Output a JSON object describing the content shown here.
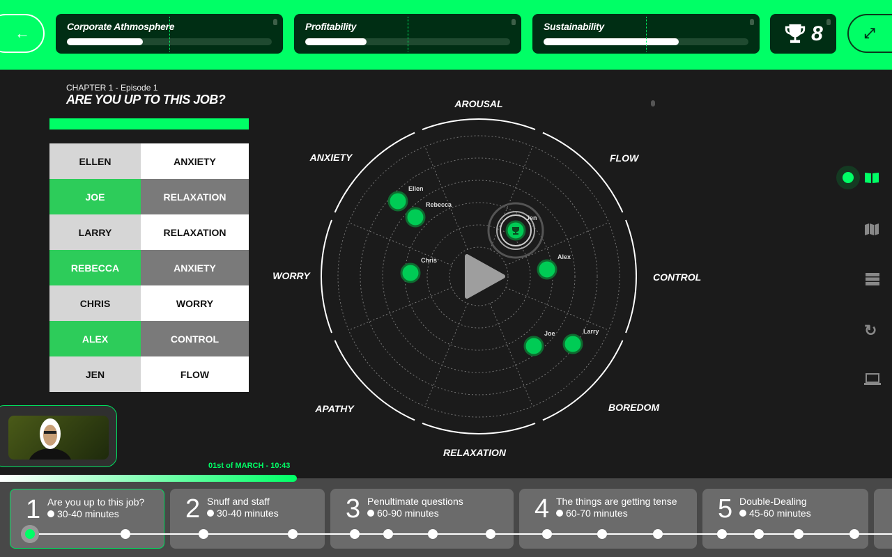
{
  "header": {
    "back_icon": "arrow-left-icon",
    "meters": [
      {
        "label": "Corporate Athmosphere",
        "value_pct": 37,
        "marker_pct": 50
      },
      {
        "label": "Profitability",
        "value_pct": 26,
        "marker_pct": 50
      },
      {
        "label": "Sustainability",
        "value_pct": 66,
        "marker_pct": 58
      }
    ],
    "trophy_count": "8",
    "fullscreen_icon": "expand-icon"
  },
  "chapter": {
    "subtitle": "CHAPTER 1 - Episode 1",
    "title": "ARE YOU UP TO THIS JOB?"
  },
  "states_table": [
    {
      "name": "ELLEN",
      "state": "ANXIETY"
    },
    {
      "name": "JOE",
      "state": "RELAXATION"
    },
    {
      "name": "LARRY",
      "state": "RELAXATION"
    },
    {
      "name": "REBECCA",
      "state": "ANXIETY"
    },
    {
      "name": "CHRIS",
      "state": "WORRY"
    },
    {
      "name": "ALEX",
      "state": "CONTROL"
    },
    {
      "name": "JEN",
      "state": "FLOW"
    }
  ],
  "radar": {
    "labels": [
      "AROUSAL",
      "FLOW",
      "CONTROL",
      "BOREDOM",
      "RELAXATION",
      "APATHY",
      "WORRY",
      "ANXIETY"
    ],
    "people": [
      "Ellen",
      "Rebecca",
      "Chris",
      "Jen",
      "Alex",
      "Joe",
      "Larry"
    ],
    "highlighted": "Jen",
    "accent": "#00cc55"
  },
  "sidebar": {
    "icons": [
      "book-icon",
      "map-icon",
      "server-icon",
      "refresh-icon",
      "laptop-icon"
    ],
    "active": "book-icon"
  },
  "timeline": {
    "date": "01st of MARCH - 10:43",
    "progress_pct": 33,
    "episodes": [
      {
        "num": "1",
        "title": "Are you up to this job?",
        "duration": "30-40 minutes"
      },
      {
        "num": "2",
        "title": "Snuff and staff",
        "duration": "30-40 minutes"
      },
      {
        "num": "3",
        "title": "Penultimate questions",
        "duration": "60-90 minutes"
      },
      {
        "num": "4",
        "title": "The things are getting tense",
        "duration": "60-70 minutes"
      },
      {
        "num": "5",
        "title": "Double-Dealing",
        "duration": "45-60 minutes"
      }
    ]
  },
  "colors": {
    "accent": "#00ff66",
    "dark": "#002e14"
  }
}
